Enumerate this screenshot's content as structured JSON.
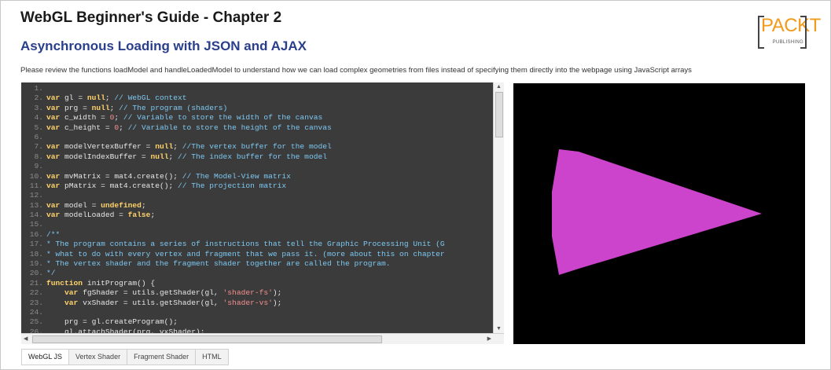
{
  "header": {
    "title": "WebGL Beginner's Guide - Chapter 2",
    "subtitle": "Asynchronous Loading with JSON and AJAX",
    "description": "Please review the functions loadModel and handleLoadedModel to understand how we can load complex geometries from files instead of specifying them directly into the webpage using JavaScript arrays"
  },
  "logo": {
    "brand": "PACKT",
    "tagline": "PUBLISHING"
  },
  "editor": {
    "lines": [
      {
        "n": "1.",
        "t": []
      },
      {
        "n": "2.",
        "t": [
          [
            "kw",
            "var"
          ],
          [
            "",
            "gl = "
          ],
          [
            "kw",
            "null"
          ],
          [
            "",
            "; "
          ],
          [
            "cm",
            "// WebGL context"
          ]
        ]
      },
      {
        "n": "3.",
        "t": [
          [
            "kw",
            "var"
          ],
          [
            "",
            "prg = "
          ],
          [
            "kw",
            "null"
          ],
          [
            "",
            "; "
          ],
          [
            "cm",
            "// The program (shaders)"
          ]
        ]
      },
      {
        "n": "4.",
        "t": [
          [
            "kw",
            "var"
          ],
          [
            "",
            "c_width = "
          ],
          [
            "st",
            "0"
          ],
          [
            "",
            "; "
          ],
          [
            "cm",
            "// Variable to store the width of the canvas"
          ]
        ]
      },
      {
        "n": "5.",
        "t": [
          [
            "kw",
            "var"
          ],
          [
            "",
            "c_height = "
          ],
          [
            "st",
            "0"
          ],
          [
            "",
            "; "
          ],
          [
            "cm",
            "// Variable to store the height of the canvas"
          ]
        ]
      },
      {
        "n": "6.",
        "t": []
      },
      {
        "n": "7.",
        "t": [
          [
            "kw",
            "var"
          ],
          [
            "",
            "modelVertexBuffer = "
          ],
          [
            "kw",
            "null"
          ],
          [
            "",
            "; "
          ],
          [
            "cm",
            "//The vertex buffer for the model"
          ]
        ]
      },
      {
        "n": "8.",
        "t": [
          [
            "kw",
            "var"
          ],
          [
            "",
            "modelIndexBuffer = "
          ],
          [
            "kw",
            "null"
          ],
          [
            "",
            "; "
          ],
          [
            "cm",
            "// The index buffer for the model"
          ]
        ]
      },
      {
        "n": "9.",
        "t": []
      },
      {
        "n": "10.",
        "t": [
          [
            "kw",
            "var"
          ],
          [
            "",
            "mvMatrix = mat4.create(); "
          ],
          [
            "cm",
            "// The Model-View matrix"
          ]
        ]
      },
      {
        "n": "11.",
        "t": [
          [
            "kw",
            "var"
          ],
          [
            "",
            "pMatrix = mat4.create(); "
          ],
          [
            "cm",
            "// The projection matrix"
          ]
        ]
      },
      {
        "n": "12.",
        "t": []
      },
      {
        "n": "13.",
        "t": [
          [
            "kw",
            "var"
          ],
          [
            "",
            "model = "
          ],
          [
            "kw",
            "undefined"
          ],
          [
            "",
            ";"
          ]
        ]
      },
      {
        "n": "14.",
        "t": [
          [
            "kw",
            "var"
          ],
          [
            "",
            "modelLoaded = "
          ],
          [
            "kw",
            "false"
          ],
          [
            "",
            ";"
          ]
        ]
      },
      {
        "n": "15.",
        "t": []
      },
      {
        "n": "16.",
        "t": [
          [
            "cm",
            "/**"
          ]
        ]
      },
      {
        "n": "17.",
        "t": [
          [
            "cm",
            "* The program contains a series of instructions that tell the Graphic Processing Unit (G"
          ]
        ]
      },
      {
        "n": "18.",
        "t": [
          [
            "cm",
            "* what to do with every vertex and fragment that we pass it. (more about this on chapter"
          ]
        ]
      },
      {
        "n": "19.",
        "t": [
          [
            "cm",
            "* The vertex shader and the fragment shader together are called the program."
          ]
        ]
      },
      {
        "n": "20.",
        "t": [
          [
            "cm",
            "*/"
          ]
        ]
      },
      {
        "n": "21.",
        "t": [
          [
            "kw",
            "function"
          ],
          [
            "",
            " initProgram() {"
          ]
        ]
      },
      {
        "n": "22.",
        "t": [
          [
            "",
            "    "
          ],
          [
            "kw",
            "var"
          ],
          [
            "",
            " fgShader = utils.getShader(gl, "
          ],
          [
            "st",
            "'shader-fs'"
          ],
          [
            "",
            ");"
          ]
        ]
      },
      {
        "n": "23.",
        "t": [
          [
            "",
            "    "
          ],
          [
            "kw",
            "var"
          ],
          [
            "",
            " vxShader = utils.getShader(gl, "
          ],
          [
            "st",
            "'shader-vs'"
          ],
          [
            "",
            ");"
          ]
        ]
      },
      {
        "n": "24.",
        "t": []
      },
      {
        "n": "25.",
        "t": [
          [
            "",
            "    prg = gl.createProgram();"
          ]
        ]
      },
      {
        "n": "26.",
        "t": [
          [
            "",
            "    gl.attachShader(prg, vxShader);"
          ]
        ]
      }
    ]
  },
  "scrollbars": {
    "up": "▲",
    "down": "▼",
    "left": "◀",
    "right": "▶"
  },
  "render": {
    "background": "#000000",
    "shape_color": "#cc44cc"
  },
  "tabs": [
    {
      "label": "WebGL JS",
      "active": true
    },
    {
      "label": "Vertex Shader",
      "active": false
    },
    {
      "label": "Fragment Shader",
      "active": false
    },
    {
      "label": "HTML",
      "active": false
    }
  ]
}
